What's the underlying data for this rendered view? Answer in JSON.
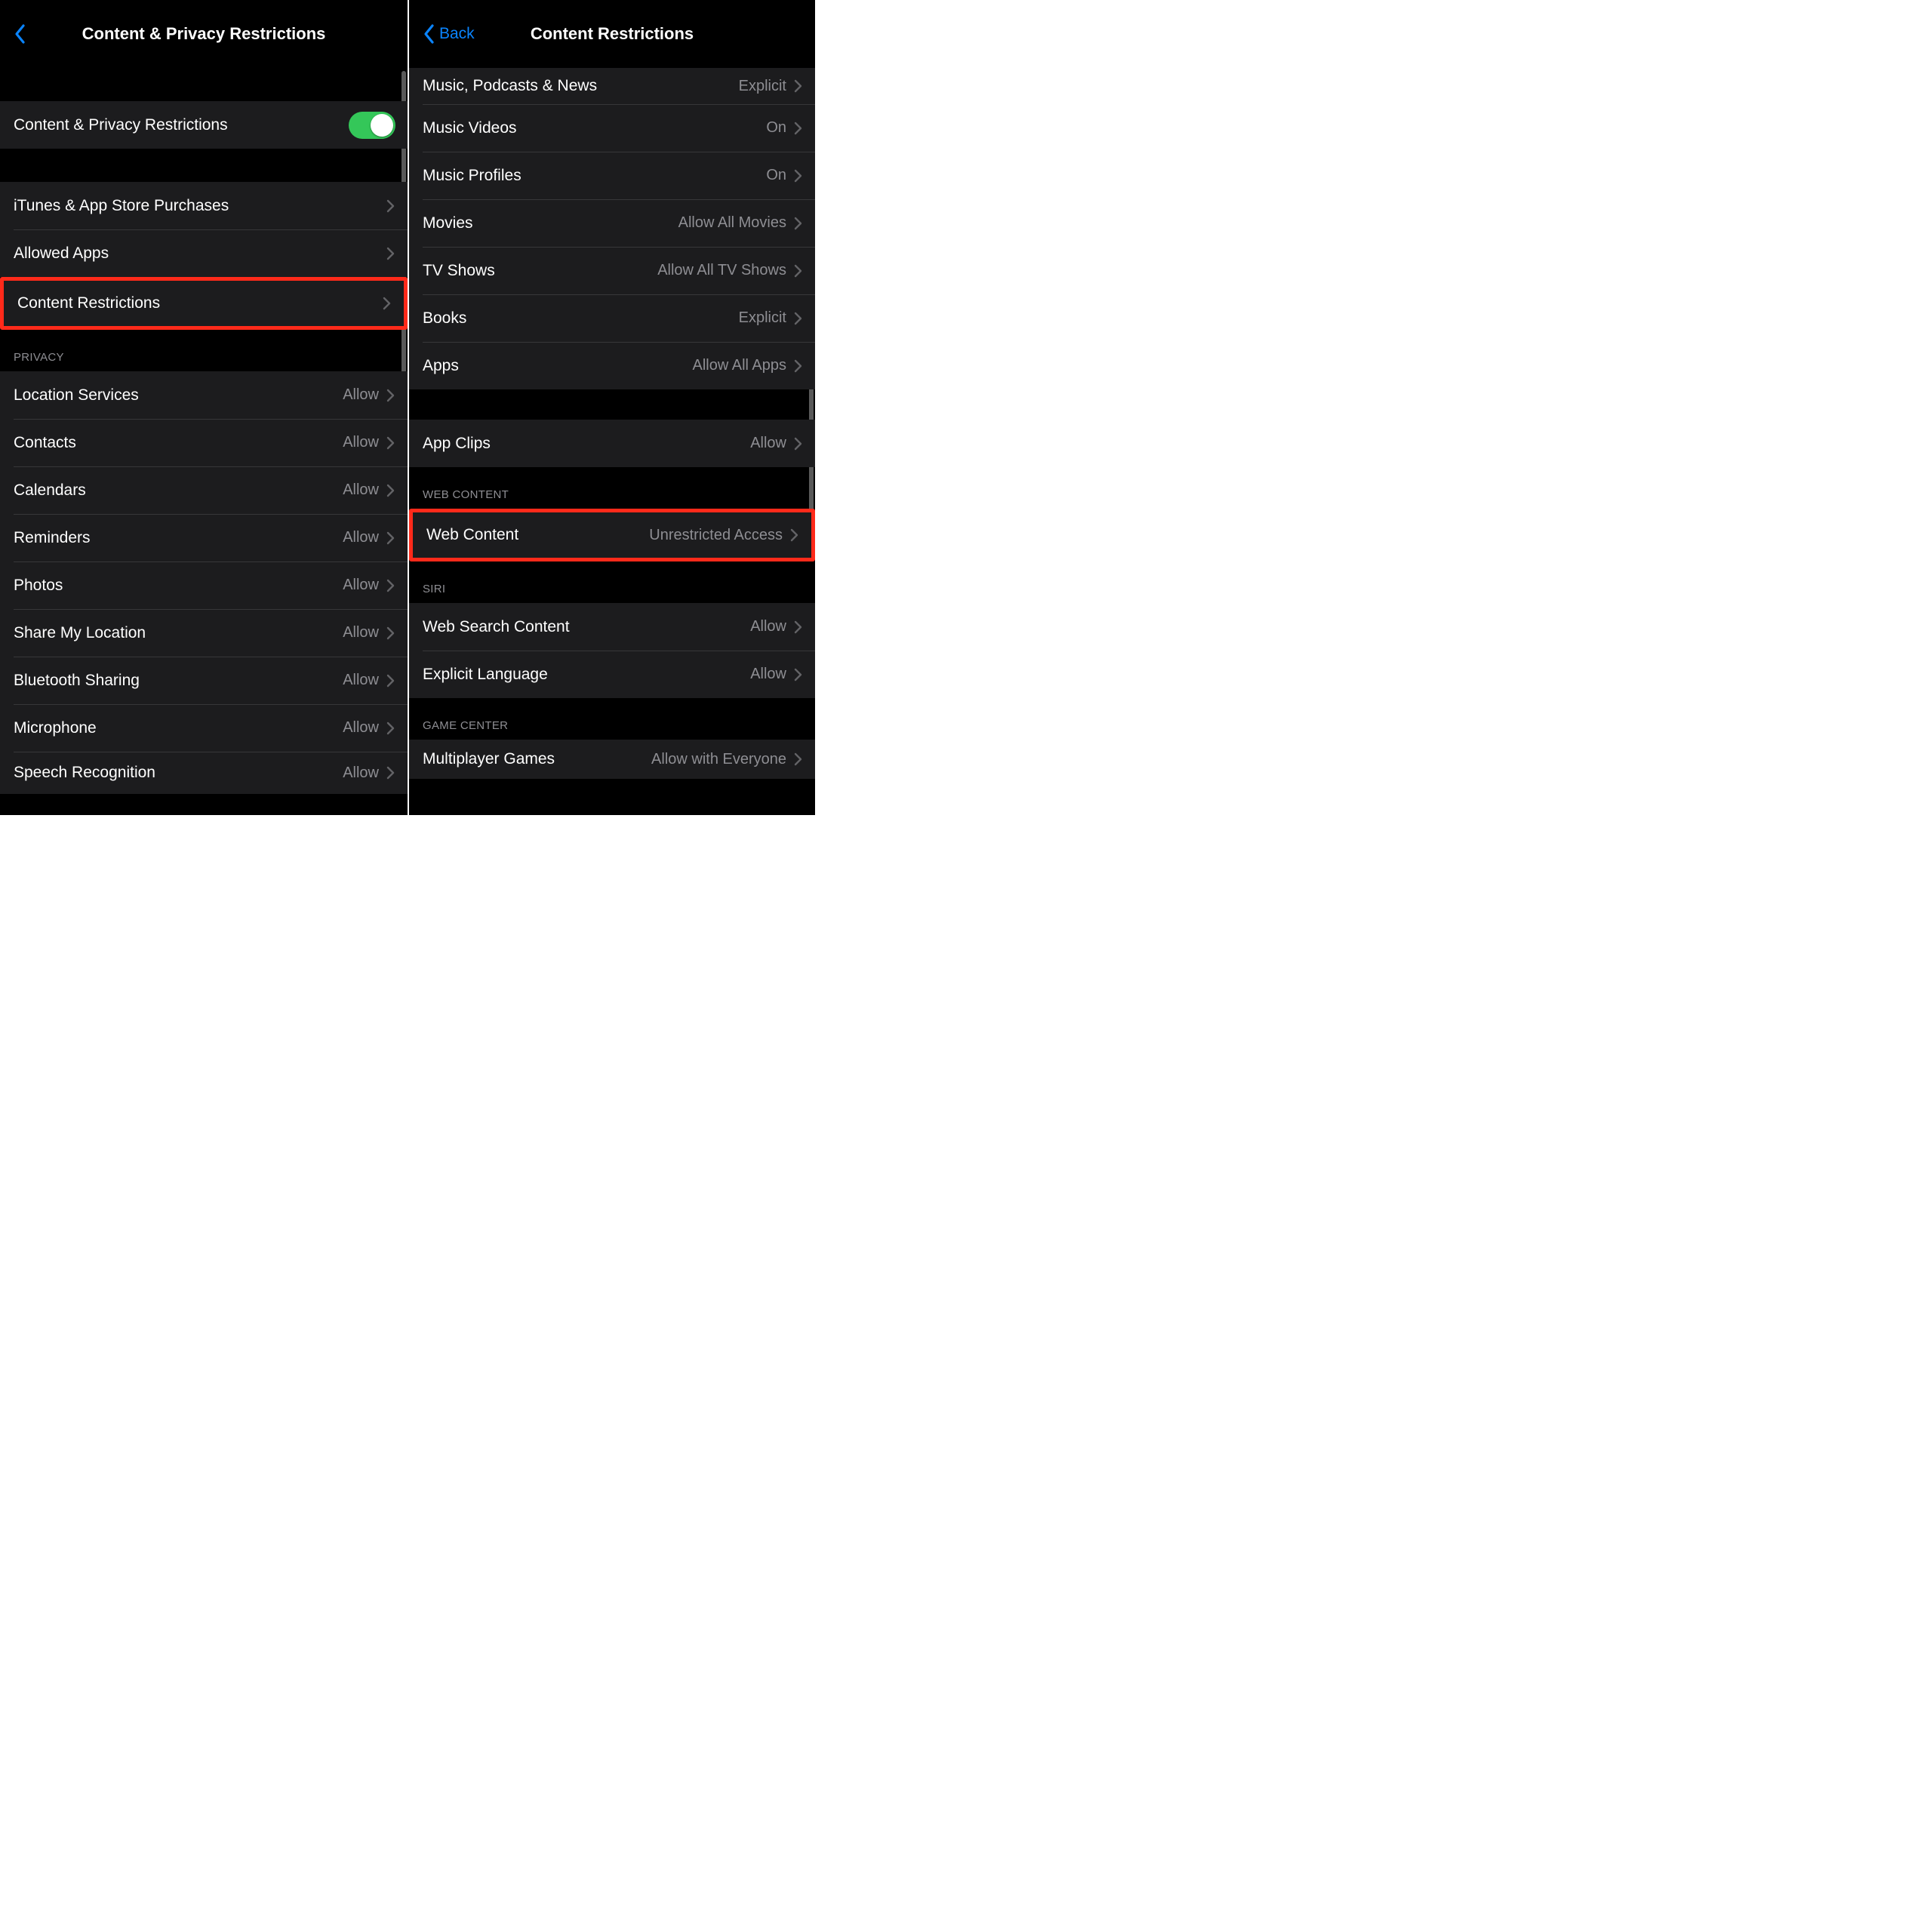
{
  "left": {
    "back_label": "",
    "title": "Content & Privacy Restrictions",
    "master_toggle": {
      "label": "Content & Privacy Restrictions",
      "on": true
    },
    "group1": [
      {
        "label": "iTunes & App Store Purchases"
      },
      {
        "label": "Allowed Apps"
      },
      {
        "label": "Content Restrictions",
        "highlighted": true
      }
    ],
    "privacy_header": "Privacy",
    "privacy_items": [
      {
        "label": "Location Services",
        "value": "Allow"
      },
      {
        "label": "Contacts",
        "value": "Allow"
      },
      {
        "label": "Calendars",
        "value": "Allow"
      },
      {
        "label": "Reminders",
        "value": "Allow"
      },
      {
        "label": "Photos",
        "value": "Allow"
      },
      {
        "label": "Share My Location",
        "value": "Allow"
      },
      {
        "label": "Bluetooth Sharing",
        "value": "Allow"
      },
      {
        "label": "Microphone",
        "value": "Allow"
      },
      {
        "label": "Speech Recognition",
        "value": "Allow"
      }
    ]
  },
  "right": {
    "back_label": "Back",
    "title": "Content Restrictions",
    "content_items": [
      {
        "label": "Music, Podcasts & News",
        "value": "Explicit"
      },
      {
        "label": "Music Videos",
        "value": "On"
      },
      {
        "label": "Music Profiles",
        "value": "On"
      },
      {
        "label": "Movies",
        "value": "Allow All Movies"
      },
      {
        "label": "TV Shows",
        "value": "Allow All TV Shows"
      },
      {
        "label": "Books",
        "value": "Explicit"
      },
      {
        "label": "Apps",
        "value": "Allow All Apps"
      }
    ],
    "app_clips": {
      "label": "App Clips",
      "value": "Allow"
    },
    "web_header": "Web Content",
    "web_item": {
      "label": "Web Content",
      "value": "Unrestricted Access",
      "highlighted": true
    },
    "siri_header": "Siri",
    "siri_items": [
      {
        "label": "Web Search Content",
        "value": "Allow"
      },
      {
        "label": "Explicit Language",
        "value": "Allow"
      }
    ],
    "gc_header": "Game Center",
    "gc_items": [
      {
        "label": "Multiplayer Games",
        "value": "Allow with Everyone"
      }
    ]
  }
}
